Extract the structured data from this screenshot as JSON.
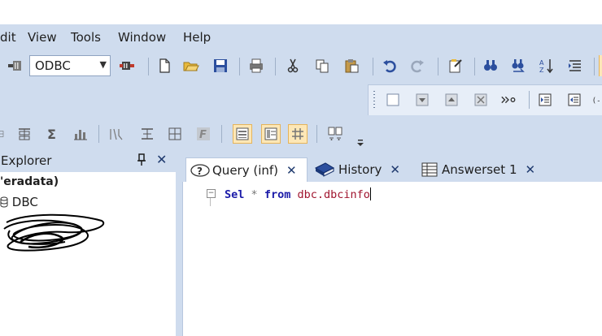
{
  "menu": {
    "items": [
      "dit",
      "View",
      "Tools",
      "Window",
      "Help"
    ]
  },
  "toolbar": {
    "connection_type": "ODBC"
  },
  "explorer": {
    "title": "Explorer",
    "tree_root": "'eradata)",
    "tree_items": [
      "DBC"
    ]
  },
  "tabs": [
    {
      "label": "Query (inf)"
    },
    {
      "label": "History"
    },
    {
      "label": "Answerset 1"
    }
  ],
  "editor": {
    "keyword_select": "Sel",
    "star": "*",
    "keyword_from": "from",
    "table": "dbc.dbcinfo"
  },
  "colors": {
    "chrome": "#cfdcee",
    "tab_close": "#1f3a6e",
    "keyword": "#1a1aa8",
    "identifier": "#a0142e"
  }
}
